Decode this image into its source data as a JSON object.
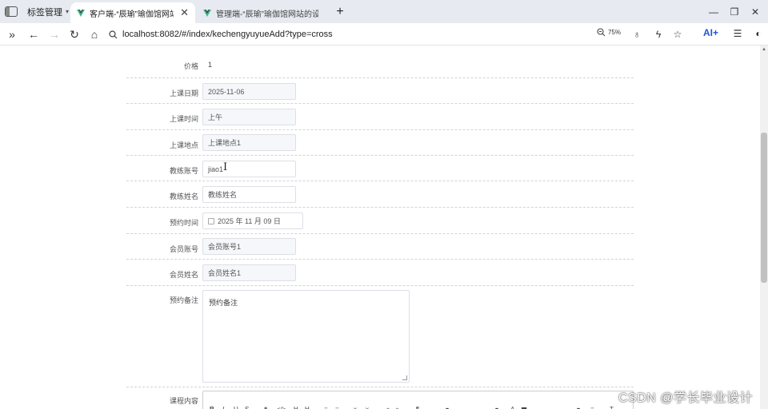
{
  "browser": {
    "tab_group": "标签管理",
    "tabs": [
      {
        "title": "客户端-“辰瑜”瑜伽馆网站的"
      },
      {
        "title": "管理端-“辰瑜”瑜伽馆网站的设"
      }
    ],
    "url": "localhost:8082/#/index/kechengyuyueAdd?type=cross",
    "zoom": "75%",
    "ai_label": "AI+"
  },
  "form": {
    "price": {
      "label": "价格",
      "value": "1"
    },
    "class_date": {
      "label": "上课日期",
      "value": "2025-11-06"
    },
    "class_time": {
      "label": "上课时间",
      "value": "上午"
    },
    "class_location": {
      "label": "上课地点",
      "value": "上课地点1"
    },
    "coach_account": {
      "label": "教练账号",
      "value": "jiao1"
    },
    "coach_name": {
      "label": "教练姓名",
      "value": "教练姓名"
    },
    "booking_time": {
      "label": "预约时间",
      "value": "2025 年 11 月 09 日"
    },
    "member_account": {
      "label": "会员账号",
      "value": "会员账号1"
    },
    "member_name": {
      "label": "会员姓名",
      "value": "会员姓名1"
    },
    "booking_note": {
      "label": "预约备注",
      "value": "预约备注"
    },
    "course_content": {
      "label": "课程内容"
    }
  },
  "watermark": "CSDN @学长毕业设计"
}
